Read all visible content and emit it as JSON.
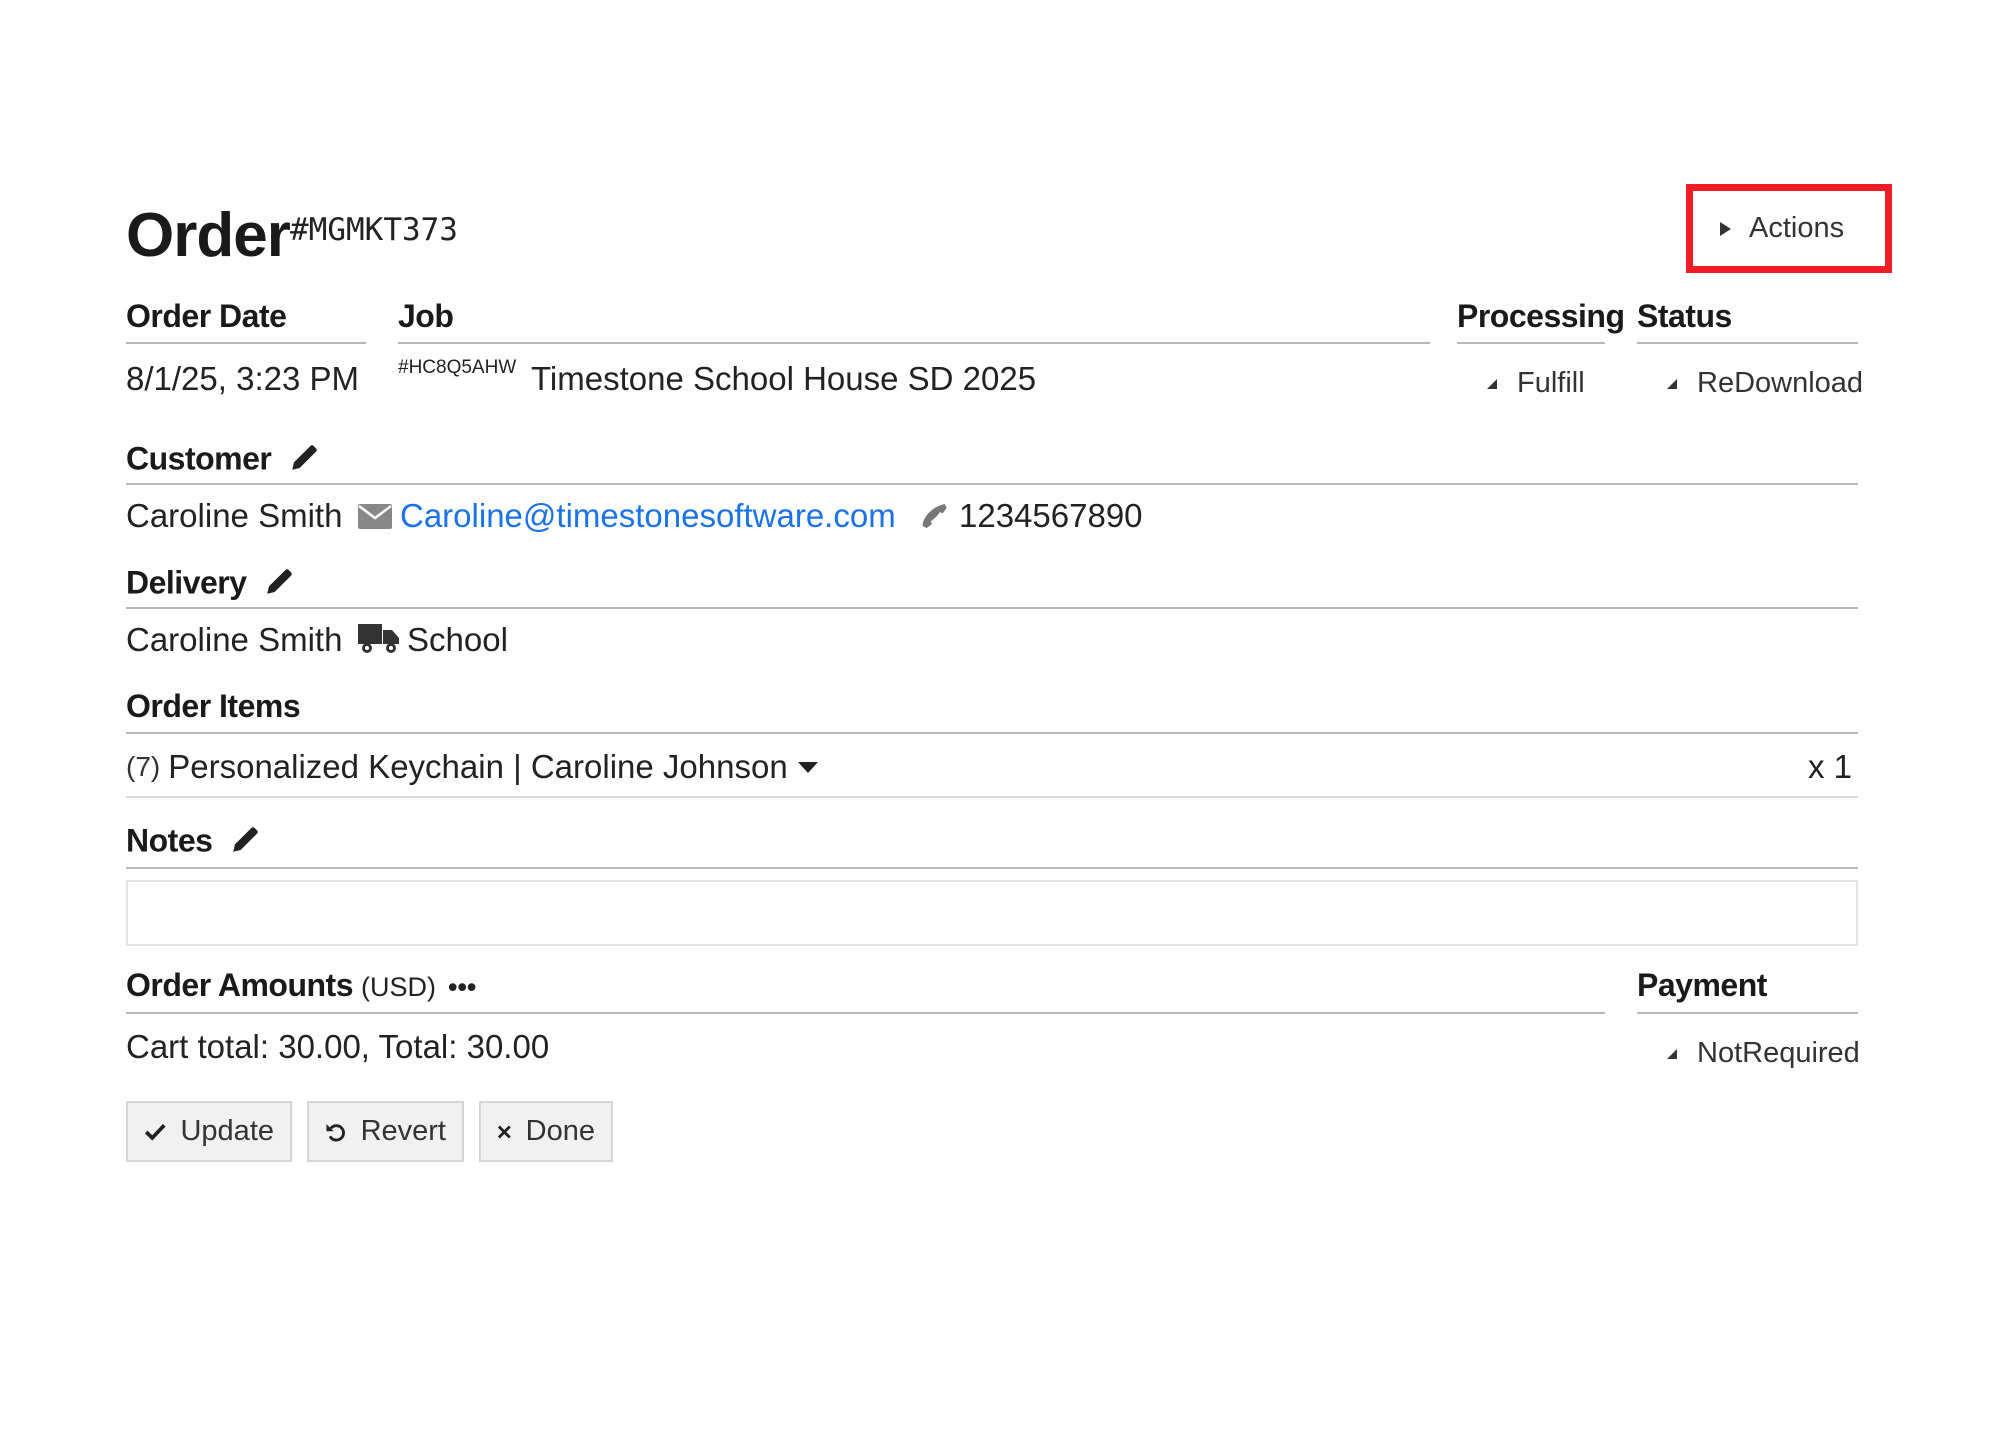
{
  "title": {
    "label": "Order",
    "code": "#MGMKT373"
  },
  "actions": {
    "label": "Actions"
  },
  "headers": {
    "order_date": "Order Date",
    "job": "Job",
    "processing": "Processing",
    "status": "Status"
  },
  "order_date": "8/1/25, 3:23 PM",
  "job": {
    "code": "#HC8Q5AHW",
    "name": "Timestone School House SD 2025"
  },
  "processing": {
    "value": "Fulfill"
  },
  "status": {
    "value": "ReDownload"
  },
  "customer": {
    "header": "Customer",
    "name": "Caroline Smith",
    "email": "Caroline@timestonesoftware.com",
    "phone": "1234567890"
  },
  "delivery": {
    "header": "Delivery",
    "name": "Caroline Smith",
    "method": "School"
  },
  "order_items": {
    "header": "Order Items",
    "items": [
      {
        "id": "(7)",
        "name": "Personalized Keychain | Caroline Johnson",
        "qty": "x 1"
      }
    ]
  },
  "notes": {
    "header": "Notes",
    "value": ""
  },
  "amounts": {
    "header": "Order Amounts",
    "currency": "(USD)",
    "more": "•••",
    "summary": "Cart total: 30.00,  Total: 30.00"
  },
  "payment": {
    "header": "Payment",
    "value": "NotRequired"
  },
  "buttons": {
    "update": "Update",
    "revert": "Revert",
    "done": "Done"
  },
  "colors": {
    "highlight": "#ee1c25",
    "link": "#1a73e8"
  }
}
